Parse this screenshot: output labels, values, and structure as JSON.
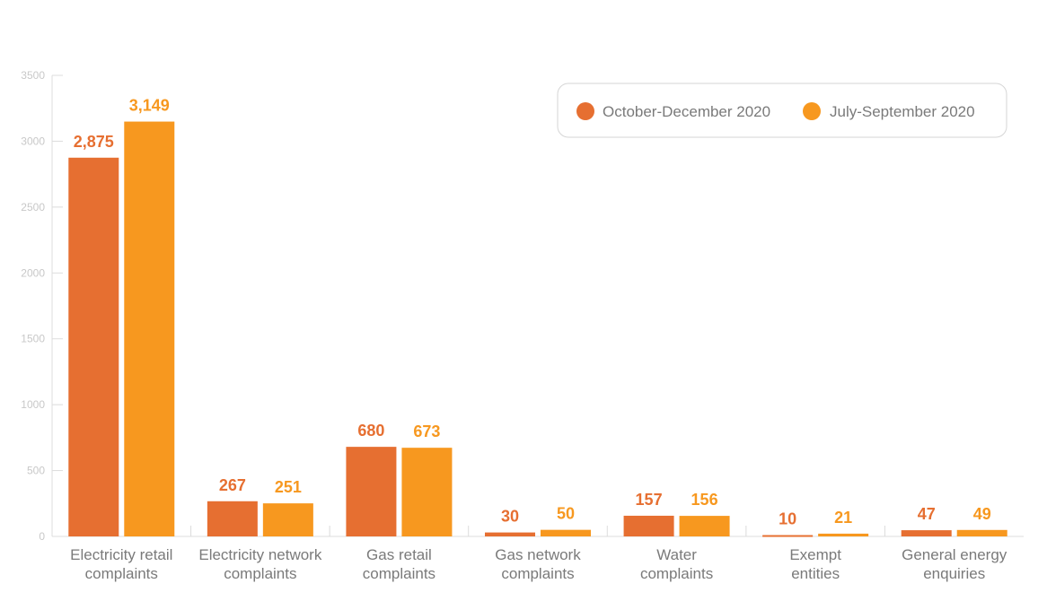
{
  "chart_data": {
    "type": "bar",
    "title": "",
    "xlabel": "",
    "ylabel": "",
    "ylim": [
      0,
      3500
    ],
    "yticks": [
      0,
      500,
      1000,
      1500,
      2000,
      2500,
      3000,
      3500
    ],
    "grid": false,
    "legend_position": "top-right",
    "categories": [
      [
        "Electricity retail",
        "complaints"
      ],
      [
        "Electricity network",
        "complaints"
      ],
      [
        "Gas retail",
        "complaints"
      ],
      [
        "Gas network",
        "complaints"
      ],
      [
        "Water",
        "complaints"
      ],
      [
        "Exempt",
        "entities"
      ],
      [
        "General energy",
        "enquiries"
      ]
    ],
    "series": [
      {
        "name": "October-December 2020",
        "color": "#e66f31",
        "values": [
          2875,
          267,
          680,
          30,
          157,
          10,
          47
        ],
        "labels": [
          "2,875",
          "267",
          "680",
          "30",
          "157",
          "10",
          "47"
        ]
      },
      {
        "name": "July-September 2020",
        "color": "#f7981f",
        "values": [
          3149,
          251,
          673,
          50,
          156,
          21,
          49
        ],
        "labels": [
          "3,149",
          "251",
          "673",
          "50",
          "156",
          "21",
          "49"
        ]
      }
    ]
  }
}
